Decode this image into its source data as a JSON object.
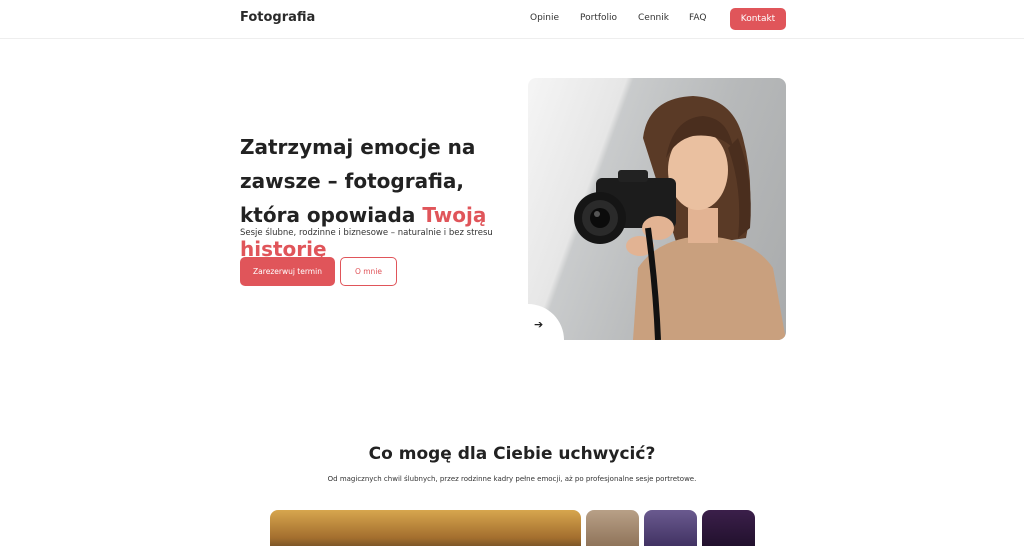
{
  "nav": {
    "logo": "Fotografia",
    "links": [
      "Opinie",
      "Portfolio",
      "Cennik",
      "FAQ"
    ],
    "cta": "Kontakt"
  },
  "hero": {
    "title_prefix": "Zatrzymaj emocje na zawsze – fotografia, która opowiada ",
    "title_accent": "Twoją historię",
    "subtitle": "Sesje ślubne, rodzinne i biznesowe – naturalnie i bez stresu",
    "primary_button": "Zarezerwuj termin",
    "secondary_button": "O mnie",
    "arrow": "➔"
  },
  "services": {
    "title": "Co mogę dla Ciebie uchwycić?",
    "subtitle": "Od magicznych chwil ślubnych, przez rodzinne kadry pełne emocji, aż po profesjonalne sesje portretowe."
  }
}
